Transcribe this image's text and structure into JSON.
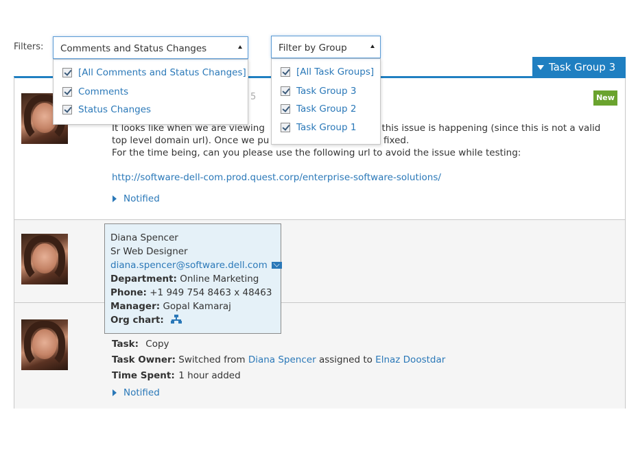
{
  "filters_label": "Filters:",
  "filter_type": {
    "selected": "Comments and Status Changes",
    "options": [
      {
        "label": "[All Comments and Status Changes]",
        "checked": true
      },
      {
        "label": "Comments",
        "checked": true
      },
      {
        "label": "Status Changes",
        "checked": true
      }
    ]
  },
  "filter_group": {
    "selected": "Filter by Group",
    "options": [
      {
        "label": "[All Task Groups]",
        "checked": true
      },
      {
        "label": "Task Group 3",
        "checked": true
      },
      {
        "label": "Task Group 2",
        "checked": true
      },
      {
        "label": "Task Group 1",
        "checked": true
      }
    ]
  },
  "task_group_tab": "Task Group 3",
  "colors": {
    "accent": "#1f7fc1",
    "link": "#2a78b8",
    "new_badge": "#6aa32e",
    "card_bg": "#e5f1f8"
  },
  "entries": [
    {
      "badge": "New",
      "frag": "5",
      "line1": "It looks like when we are viewing",
      "line1_tail": "m this issue is happening (since this is not a valid",
      "line2": "top level domain url). Once we pu",
      "line2_tail": "fixed.",
      "line3": "For the time being, can you please use the following url to avoid the issue while testing:",
      "url": "http://software-dell-com.prod.quest.corp/enterprise-software-solutions/",
      "notified": "Notified"
    },
    {
      "task_label": "Task:",
      "task_value": "Copy",
      "owner_label": "Task Owner:",
      "owner_prefix": "Switched from",
      "owner_from": "Diana Spencer",
      "owner_mid": "assigned to",
      "owner_to": "Elnaz Doostdar",
      "time_label": "Time Spent:",
      "time_value": "1 hour added",
      "notified": "Notified"
    }
  ],
  "contact_card": {
    "name": "Diana Spencer",
    "title": "Sr Web Designer",
    "email": "diana.spencer@software.dell.com",
    "department_label": "Department:",
    "department": "Online Marketing",
    "phone_label": "Phone:",
    "phone": "+1 949 754 8463 x 48463",
    "manager_label": "Manager:",
    "manager": "Gopal Kamaraj",
    "org_label": "Org chart:"
  }
}
